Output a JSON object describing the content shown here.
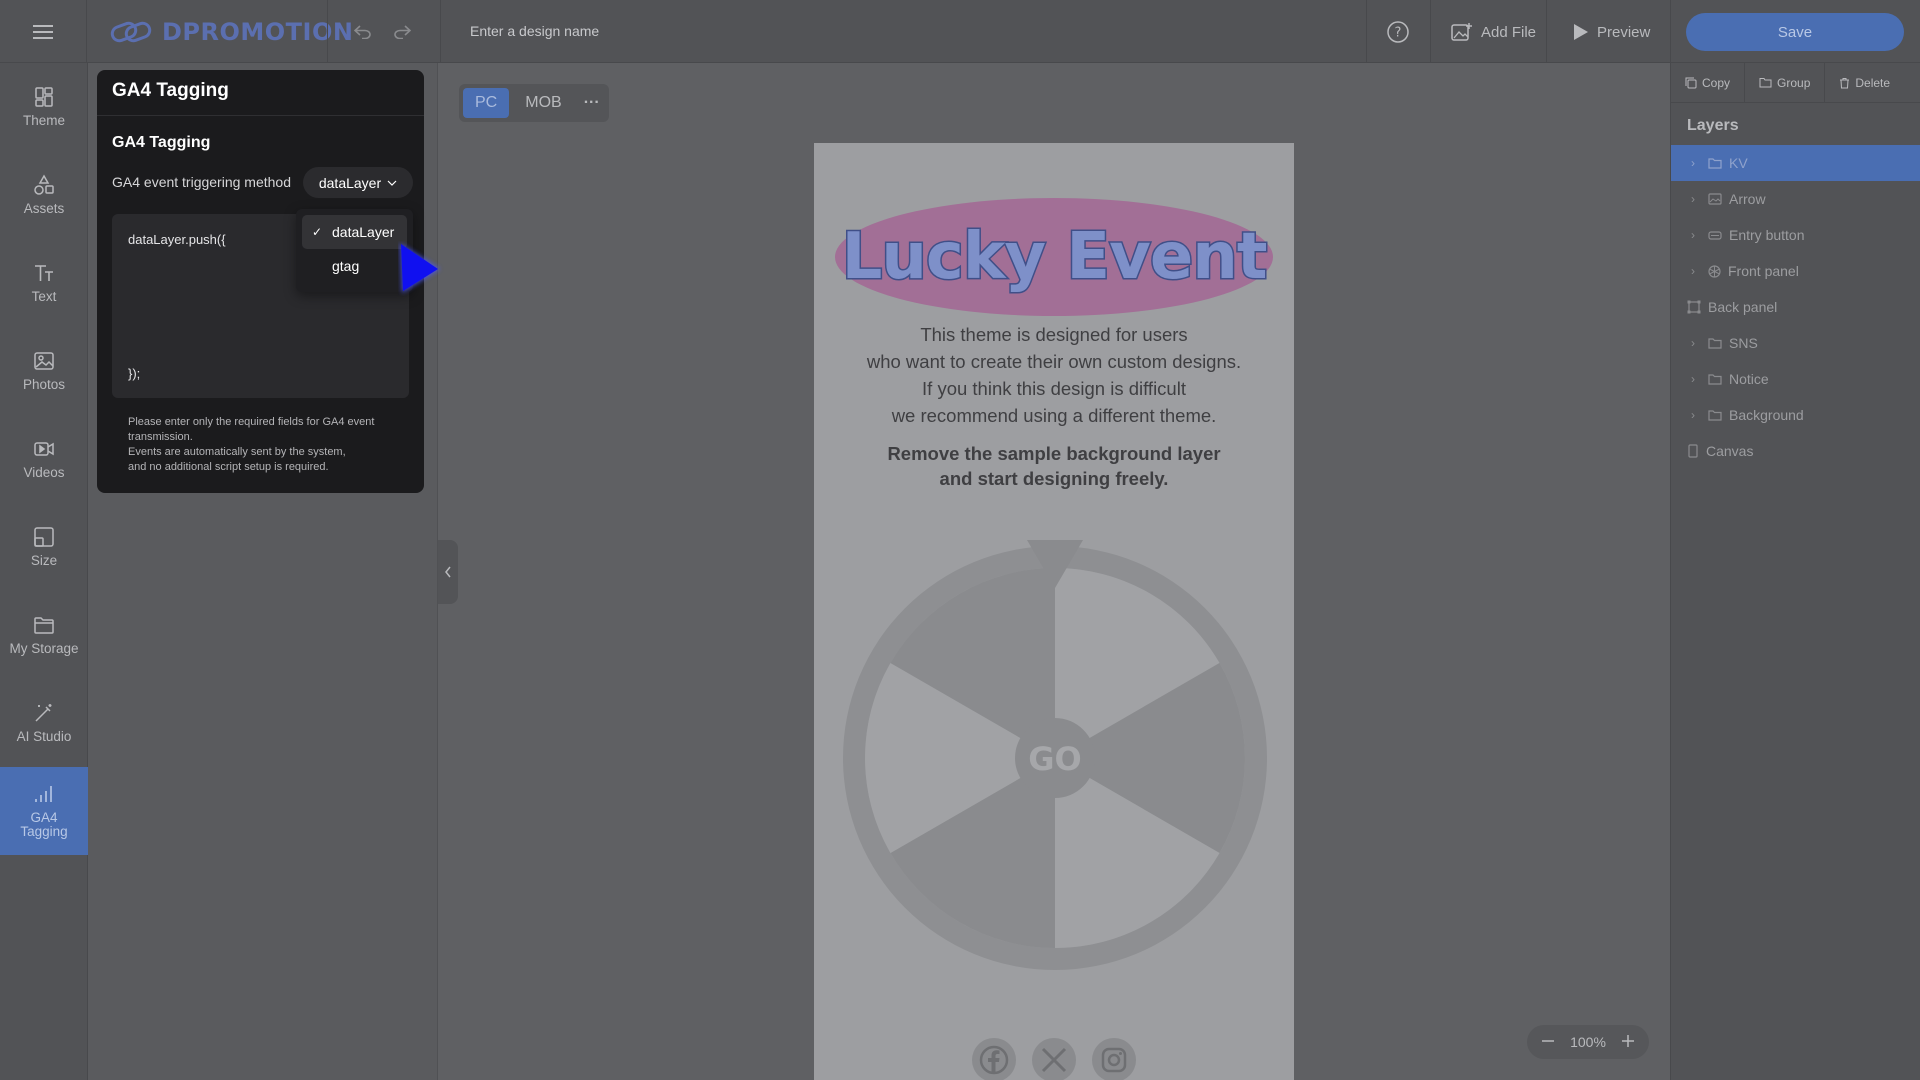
{
  "header": {
    "logo": "DPROMOTION",
    "design_name_placeholder": "Enter a design name",
    "add_file": "Add File",
    "preview": "Preview",
    "save": "Save"
  },
  "nav": {
    "items": [
      {
        "label": "Theme",
        "icon": "theme-icon"
      },
      {
        "label": "Assets",
        "icon": "assets-icon"
      },
      {
        "label": "Text",
        "icon": "text-icon"
      },
      {
        "label": "Photos",
        "icon": "photos-icon"
      },
      {
        "label": "Videos",
        "icon": "videos-icon"
      },
      {
        "label": "Size",
        "icon": "size-icon"
      },
      {
        "label": "My Storage",
        "icon": "folder-icon"
      },
      {
        "label": "AI Studio",
        "icon": "magic-wand-icon"
      },
      {
        "label": "GA4\nTagging",
        "icon": "bar-chart-icon"
      }
    ]
  },
  "ga_panel": {
    "title": "GA4 Tagging",
    "subtitle": "GA4 Tagging",
    "method_label": "GA4 event triggering method",
    "selected_method": "dataLayer",
    "code_open": "dataLayer.push({",
    "code_close": "});",
    "note": "Please enter only the required fields for GA4 event transmission.\n Events are automatically sent by the system,\nand no additional script setup is required.",
    "options": [
      {
        "label": "dataLayer",
        "selected": true
      },
      {
        "label": "gtag",
        "selected": false
      }
    ]
  },
  "canvas": {
    "view_pc": "PC",
    "view_mob": "MOB",
    "more": "···",
    "title": "Lucky Event",
    "description": [
      "This theme is designed for users",
      "who want to create their own custom designs.",
      "If you think this design is difficult",
      "we recommend using a different theme."
    ],
    "description_bold": [
      "Remove the sample background layer",
      "and start designing freely."
    ],
    "wheel_center": "GO",
    "zoom": "100%"
  },
  "right_panel": {
    "copy": "Copy",
    "group": "Group",
    "delete": "Delete",
    "layers_title": "Layers",
    "layers": [
      {
        "label": "KV",
        "type": "folder",
        "expandable": true
      },
      {
        "label": "Arrow",
        "type": "image",
        "expandable": true
      },
      {
        "label": "Entry button",
        "type": "button",
        "expandable": true
      },
      {
        "label": "Front panel",
        "type": "spinner",
        "expandable": true
      },
      {
        "label": "Back panel",
        "type": "frame",
        "expandable": false
      },
      {
        "label": "SNS",
        "type": "folder",
        "expandable": true
      },
      {
        "label": "Notice",
        "type": "folder",
        "expandable": true
      },
      {
        "label": "Background",
        "type": "folder",
        "expandable": true
      },
      {
        "label": "Canvas",
        "type": "page",
        "expandable": false
      }
    ]
  },
  "colors": {
    "accent": "#4a6eb2",
    "panel_bg": "#1b1b1d",
    "title_ellipse": "#a26f96"
  }
}
